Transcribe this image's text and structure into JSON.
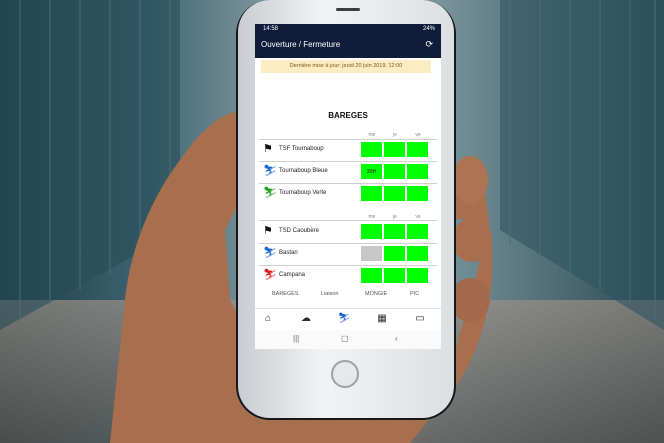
{
  "status": {
    "time": "14:58",
    "right": "24%"
  },
  "app": {
    "title": "Ouverture / Fermeture",
    "refresh_icon": "refresh-icon"
  },
  "notice": "Dernière mise à jour: jeudi 20 juin 2019, 12:00",
  "section_title": "BAREGES",
  "day_headers": [
    "me",
    "je",
    "ve"
  ],
  "group1": [
    {
      "name": "TSF Tournaboup",
      "icon": "chairlift-icon",
      "icon_color": "#111111",
      "cells": [
        "",
        "",
        ""
      ],
      "cell_colors": [
        "#00ff00",
        "#00ff00",
        "#00ff00"
      ]
    },
    {
      "name": "Tournaboup Bleue",
      "icon": "skier-icon",
      "icon_color": "#1a66d6",
      "cells": [
        "20H",
        "",
        ""
      ],
      "cell_colors": [
        "#00ff00",
        "#00ff00",
        "#00ff00"
      ]
    },
    {
      "name": "Tournaboup Verte",
      "icon": "skier-icon",
      "icon_color": "#1aa31a",
      "cells": [
        "",
        "",
        ""
      ],
      "cell_colors": [
        "#00ff00",
        "#00ff00",
        "#00ff00"
      ]
    }
  ],
  "group2": [
    {
      "name": "TSD Caoubère",
      "icon": "chairlift-icon",
      "icon_color": "#111111",
      "cells": [
        "",
        "",
        ""
      ],
      "cell_colors": [
        "#00ff00",
        "#00ff00",
        "#00ff00"
      ]
    },
    {
      "name": "Bastan",
      "icon": "skier-icon",
      "icon_color": "#1a66d6",
      "cells": [
        "",
        "",
        ""
      ],
      "cell_colors": [
        "#c8c8c8",
        "#00ff00",
        "#00ff00"
      ]
    },
    {
      "name": "Campana",
      "icon": "skier-icon",
      "icon_color": "#e01c1c",
      "cells": [
        "",
        "",
        ""
      ],
      "cell_colors": [
        "#00ff00",
        "#00ff00",
        "#00ff00"
      ]
    }
  ],
  "tabs": [
    "BAREGES",
    "Liaison",
    "MONGIE",
    "PIC"
  ],
  "nav_icons": [
    "home-icon",
    "weather-icon",
    "skier-icon",
    "calendar-icon",
    "bus-icon"
  ],
  "colors": {
    "appbar": "#0f1d3a",
    "open": "#00ff00",
    "closed": "#c8c8c8"
  }
}
